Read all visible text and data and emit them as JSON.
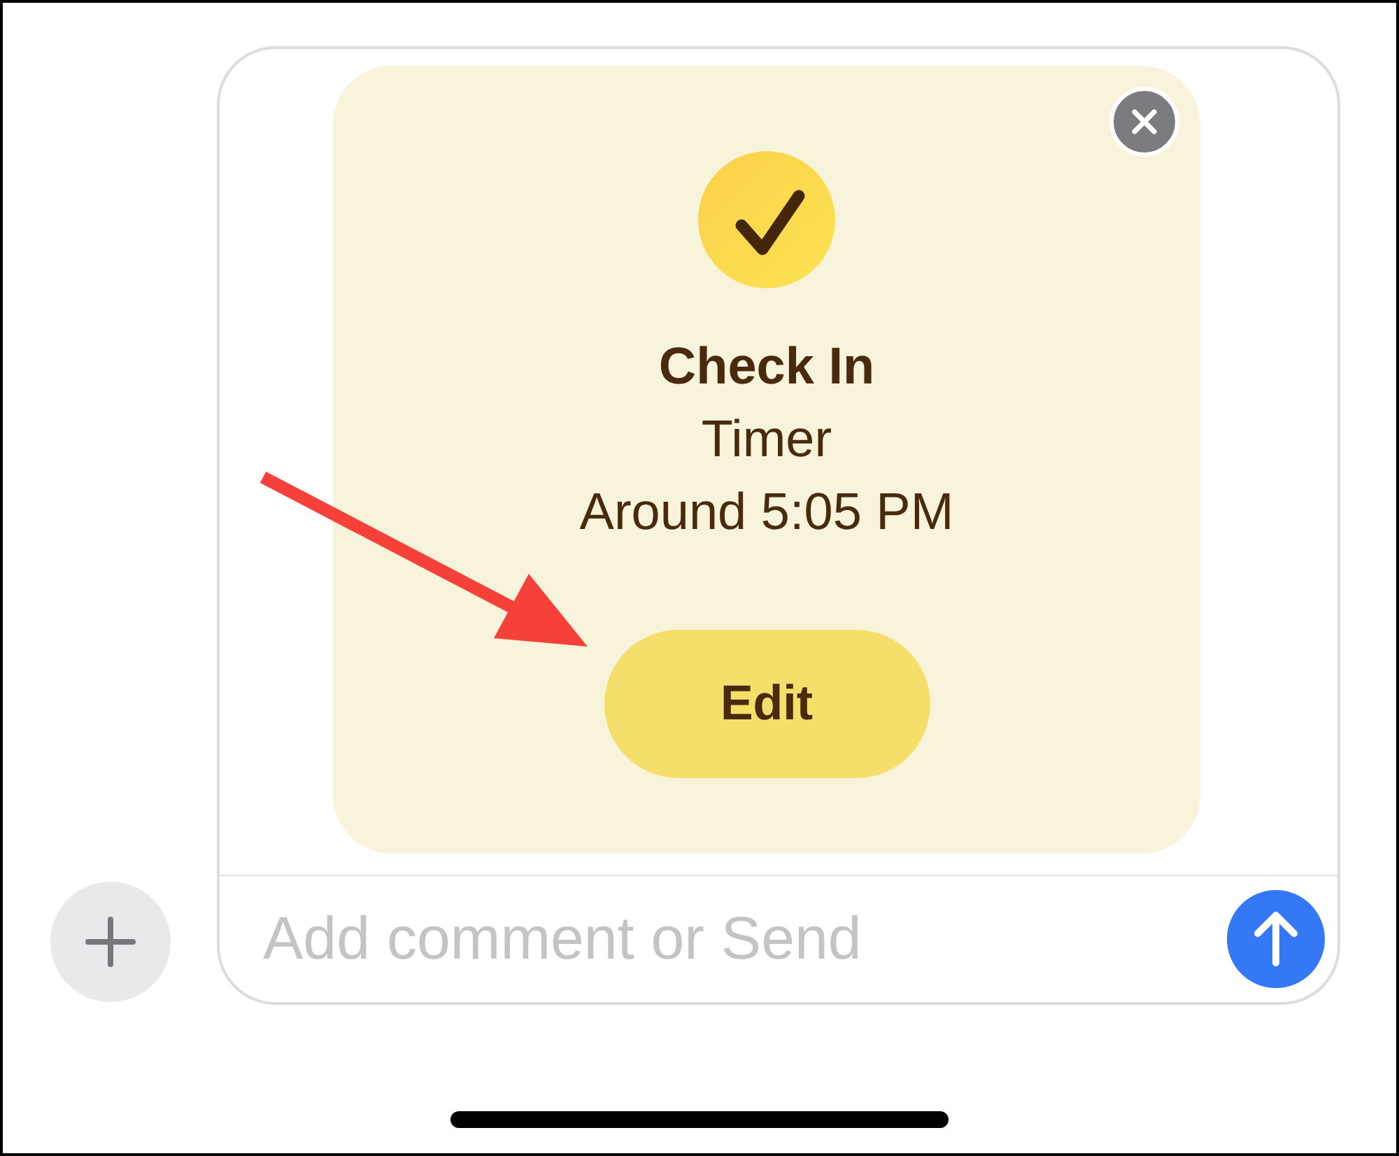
{
  "check_in_card": {
    "title": "Check In",
    "type_label": "Timer",
    "time": "Around 5:05 PM",
    "edit_button": "Edit"
  },
  "comment_field": {
    "placeholder": "Add comment or Send"
  }
}
